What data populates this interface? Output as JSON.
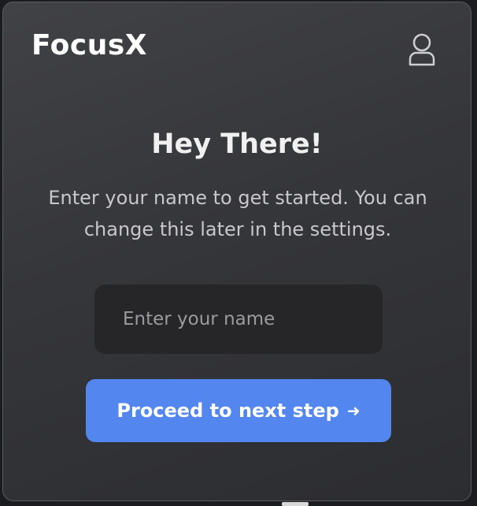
{
  "app": {
    "brand": "FocusX"
  },
  "header": {
    "profile_icon": "user-icon"
  },
  "onboarding": {
    "title": "Hey There!",
    "subtitle": "Enter your name to get started. You can change this later in the settings.",
    "name_input": {
      "placeholder": "Enter your name",
      "value": ""
    },
    "proceed_button": {
      "label": "Proceed to next step",
      "icon": "arrow-right-icon",
      "color": "#5386EE"
    }
  }
}
